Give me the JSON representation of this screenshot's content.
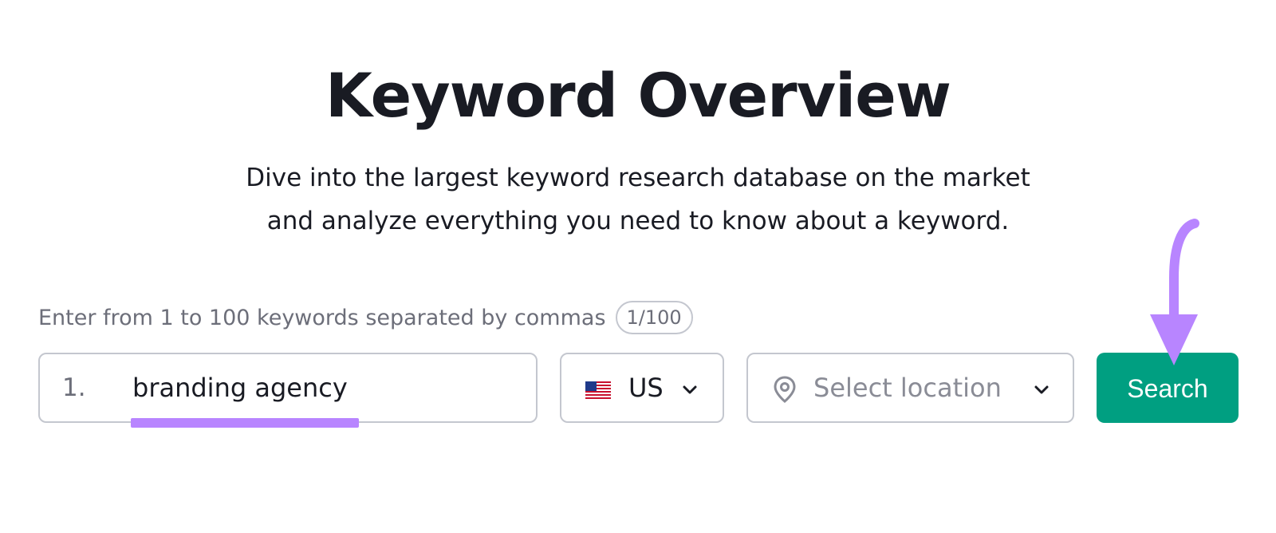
{
  "header": {
    "title": "Keyword Overview",
    "subtitle_line1": "Dive into the largest keyword research database on the market",
    "subtitle_line2": "and analyze everything you need to know about a keyword."
  },
  "form": {
    "hint": "Enter from 1 to 100 keywords separated by commas",
    "counter": "1/100",
    "keyword": {
      "index": "1.",
      "value": "branding agency"
    },
    "database": {
      "flag_icon": "us-flag-icon",
      "value": "US"
    },
    "location": {
      "icon": "location-pin-icon",
      "placeholder": "Select location"
    },
    "search_label": "Search",
    "colors": {
      "accent_button": "#009f81",
      "annotation": "#b885ff"
    }
  }
}
